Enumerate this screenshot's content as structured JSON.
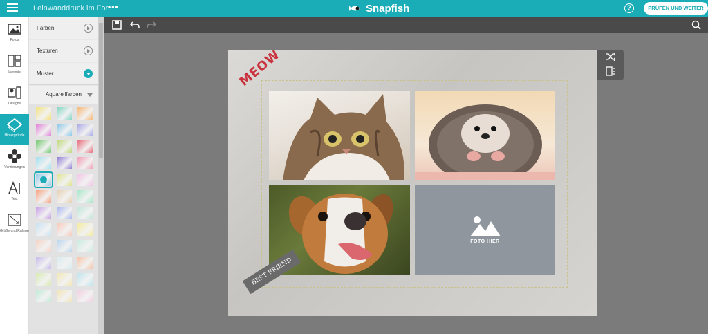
{
  "header": {
    "doc_title": "Leinwanddruck im For...",
    "more": "•••",
    "brand": "Snapfish",
    "help": "?",
    "continue_label": "PRÜFEN UND WEITER"
  },
  "leftnav": [
    {
      "label": "Fotos",
      "icon": "photos-icon"
    },
    {
      "label": "Layouts",
      "icon": "layouts-icon"
    },
    {
      "label": "Designs",
      "icon": "designs-icon"
    },
    {
      "label": "Hintergründe",
      "icon": "backgrounds-icon",
      "active": true
    },
    {
      "label": "Verzierungen",
      "icon": "embellishments-icon"
    },
    {
      "label": "Text",
      "icon": "text-icon"
    },
    {
      "label": "Größe und Rahmen",
      "icon": "size-frame-icon"
    }
  ],
  "panel": {
    "sections": [
      "Farben",
      "Texturen",
      "Muster"
    ],
    "subcategory": "Aquarellfarben"
  },
  "canvas": {
    "meow_text": "MEOW",
    "banner_text": "BEST FRIEND",
    "placeholder_text": "FOTO HIER"
  },
  "colors": {
    "accent": "#1aacb7",
    "toolbar": "#4a4a4a"
  }
}
